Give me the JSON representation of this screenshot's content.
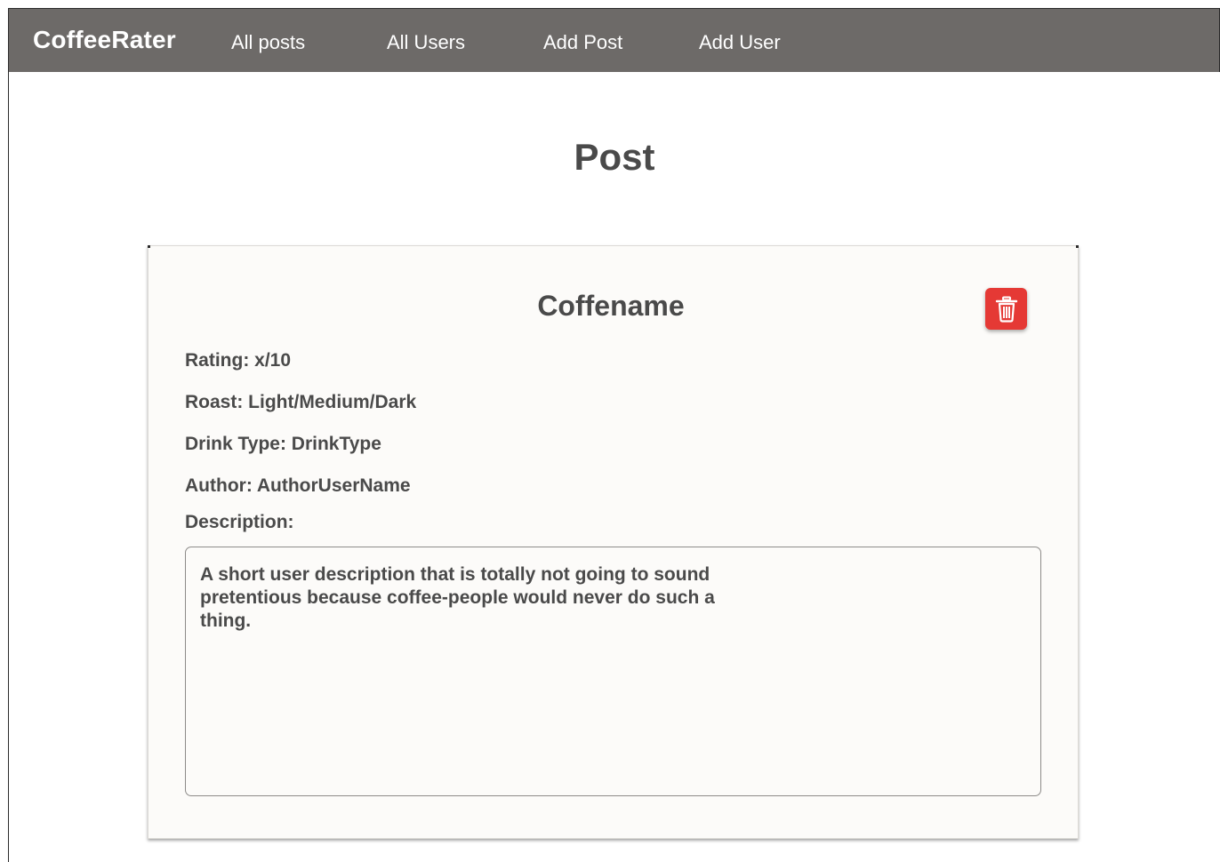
{
  "navbar": {
    "brand": "CoffeeRater",
    "links": [
      {
        "label": "All posts"
      },
      {
        "label": "All Users"
      },
      {
        "label": "Add Post"
      },
      {
        "label": "Add User"
      }
    ]
  },
  "page": {
    "title": "Post"
  },
  "post": {
    "name": "Coffename",
    "rating": "Rating: x/10",
    "roast": "Roast: Light/Medium/Dark",
    "drink_type": "Drink Type: DrinkType",
    "author": "Author: AuthorUserName",
    "description_label": "Description:",
    "description": "A short user description that is totally not going to sound pretentious because coffee-people would never do such a thing.",
    "delete_icon": "trash-icon"
  },
  "colors": {
    "navbar": "#6d6a68",
    "delete": "#e53935",
    "text": "#4a4a4a",
    "card": "#fcfbf9"
  }
}
